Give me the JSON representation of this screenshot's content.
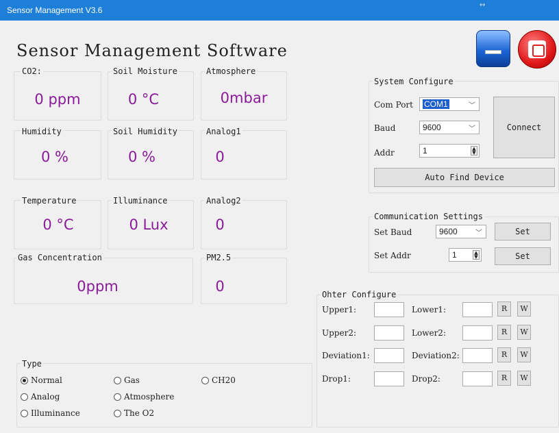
{
  "window": {
    "title": "Sensor Management V3.6",
    "resize_glyph": "↔"
  },
  "app": {
    "title": "Sensor Management Software"
  },
  "sensors": [
    {
      "label": "CO2:",
      "value": "0 ppm"
    },
    {
      "label": "Soil Moisture",
      "value": "0 °C"
    },
    {
      "label": "Atmosphere",
      "value": "0mbar"
    },
    {
      "label": "Humidity",
      "value": "0 %"
    },
    {
      "label": "Soil Humidity",
      "value": "0 %"
    },
    {
      "label": "Analog1",
      "value": "0"
    },
    {
      "label": "Temperature",
      "value": "0 °C"
    },
    {
      "label": "Illuminance",
      "value": "0 Lux"
    },
    {
      "label": "Analog2",
      "value": "0"
    },
    {
      "label": "Gas Concentration",
      "value": "0ppm"
    },
    {
      "label": "PM2.5",
      "value": "0"
    }
  ],
  "system_configure": {
    "title": "System Configure",
    "com_port_label": "Com Port",
    "com_port_value": "COM1",
    "baud_label": "Baud",
    "baud_value": "9600",
    "addr_label": "Addr",
    "addr_value": "1",
    "connect_label": "Connect",
    "auto_find_label": "Auto Find Device"
  },
  "communication_settings": {
    "title": "Communication Settings",
    "set_baud_label": "Set Baud",
    "set_baud_value": "9600",
    "set_addr_label": "Set Addr",
    "set_addr_value": "1",
    "set_label": "Set"
  },
  "other_configure": {
    "title": "Ohter Configure",
    "rows": [
      {
        "left": "Upper1:",
        "right": "Lower1:"
      },
      {
        "left": "Upper2:",
        "right": "Lower2:"
      },
      {
        "left": "Deviation1:",
        "right": "Deviation2:"
      },
      {
        "left": "Drop1:",
        "right": "Drop2:"
      }
    ],
    "r_label": "R",
    "w_label": "W"
  },
  "type": {
    "title": "Type",
    "options": [
      "Normal",
      "Gas",
      "CH20",
      "Analog",
      "Atmosphere",
      "Illuminance",
      "The O2"
    ],
    "selected": "Normal"
  }
}
